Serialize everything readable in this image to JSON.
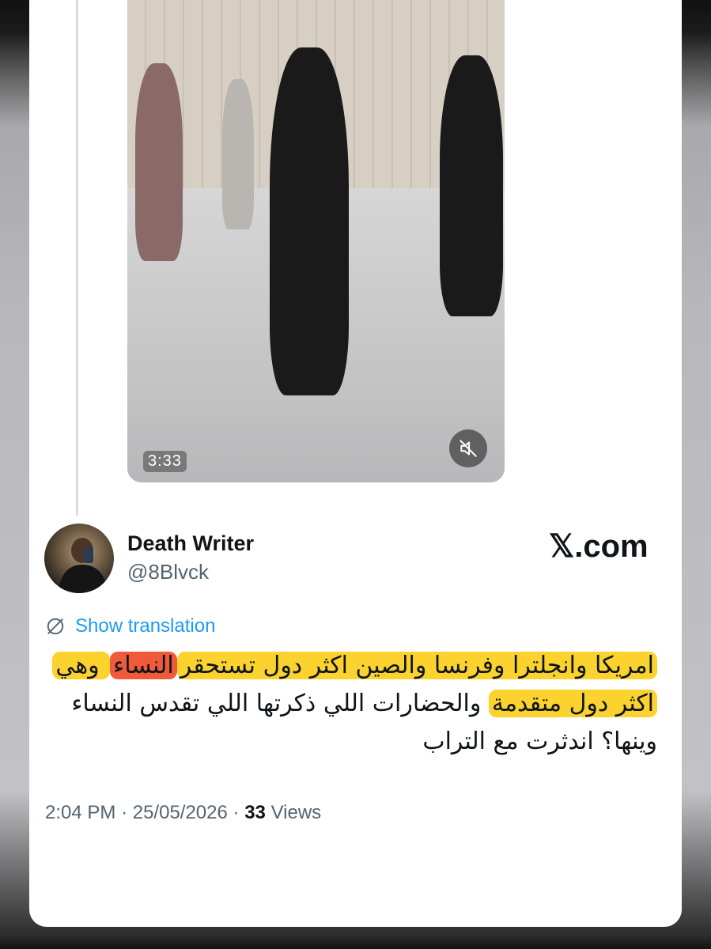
{
  "video": {
    "duration": "3:33",
    "mute_icon": "speaker-muted-icon"
  },
  "author": {
    "name": "Death Writer",
    "handle": "@8Blvck"
  },
  "brand": "𝕏.com",
  "translate": {
    "icon": "globe-slash-icon",
    "label": "Show translation"
  },
  "tweet": {
    "line1_a": "امريكا وانجلترا وفرنسا والصين اكثر دول ",
    "line1_b": "تستحقر",
    "line1_c": "النساء",
    "line1_d": " وهي",
    "line2_a": "اكثر دول متقدمة",
    "line2_b": " والحضارات اللي ذكرتها اللي تقدس النساء",
    "line3": "وينها؟ اندثرت مع التراب"
  },
  "meta": {
    "time": "2:04 PM",
    "sep": "·",
    "date": "25/05/2026",
    "views_count": "33",
    "views_label": "Views"
  },
  "colors": {
    "highlight_yellow": "#fbd22e",
    "highlight_red": "#ef5a3a",
    "link_blue": "#1d9bf0"
  }
}
